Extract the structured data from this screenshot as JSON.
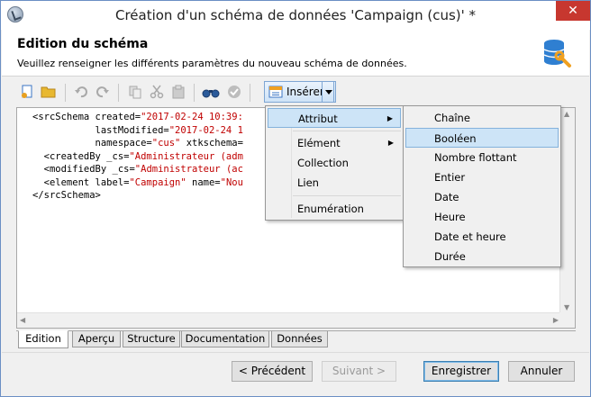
{
  "window": {
    "title": "Création d'un schéma de données 'Campaign (cus)' *",
    "close_label": "✕"
  },
  "header": {
    "title": "Edition du schéma",
    "description": "Veuillez renseigner les différents paramètres du nouveau schéma de données."
  },
  "toolbar": {
    "insert_label": "Insérer",
    "icons": [
      "new-document-icon",
      "open-folder-icon",
      "undo-icon",
      "redo-icon",
      "copy-icon",
      "cut-icon",
      "paste-icon",
      "find-icon",
      "check-icon",
      "insert-icon"
    ]
  },
  "editor": {
    "lines": [
      {
        "pre": "<srcSchema created=",
        "str": "\"2017-02-24 10:39:",
        "post": ""
      },
      {
        "pre": "           lastModified=",
        "str": "\"2017-02-24 1",
        "post": ""
      },
      {
        "pre": "           namespace=",
        "str": "\"cus\"",
        "post": " xtkschema="
      },
      {
        "pre": "  <createdBy _cs=",
        "str": "\"Administrateur (adm",
        "post": ""
      },
      {
        "pre": "  <modifiedBy _cs=",
        "str": "\"Administrateur (ac",
        "post": ""
      },
      {
        "pre": "  <element label=",
        "str": "\"Campaign\"",
        "post": " name=\"Nou"
      },
      {
        "pre": "</srcSchema>",
        "str": "",
        "post": ""
      }
    ]
  },
  "tabs": [
    {
      "label": "Edition",
      "active": true
    },
    {
      "label": "Aperçu",
      "active": false
    },
    {
      "label": "Structure",
      "active": false
    },
    {
      "label": "Documentation",
      "active": false
    },
    {
      "label": "Données",
      "active": false
    }
  ],
  "insert_menu": {
    "items": [
      {
        "label": "Attribut",
        "submenu": true,
        "highlighted": true
      },
      {
        "label": "Elément",
        "submenu": true,
        "highlighted": false
      },
      {
        "label": "Collection",
        "submenu": false,
        "highlighted": false
      },
      {
        "label": "Lien",
        "submenu": false,
        "highlighted": false
      },
      {
        "label": "Enumération",
        "submenu": false,
        "highlighted": false
      }
    ]
  },
  "attribute_submenu": {
    "items": [
      {
        "label": "Chaîne",
        "highlighted": false
      },
      {
        "label": "Booléen",
        "highlighted": true
      },
      {
        "label": "Nombre flottant",
        "highlighted": false
      },
      {
        "label": "Entier",
        "highlighted": false
      },
      {
        "label": "Date",
        "highlighted": false
      },
      {
        "label": "Heure",
        "highlighted": false
      },
      {
        "label": "Date et heure",
        "highlighted": false
      },
      {
        "label": "Durée",
        "highlighted": false
      }
    ]
  },
  "buttons": {
    "previous": "< Précédent",
    "next": "Suivant >",
    "save": "Enregistrer",
    "cancel": "Annuler"
  },
  "colors": {
    "code_string": "#c00000",
    "menu_highlight": "#cde4f7",
    "close_button": "#c7372f"
  }
}
